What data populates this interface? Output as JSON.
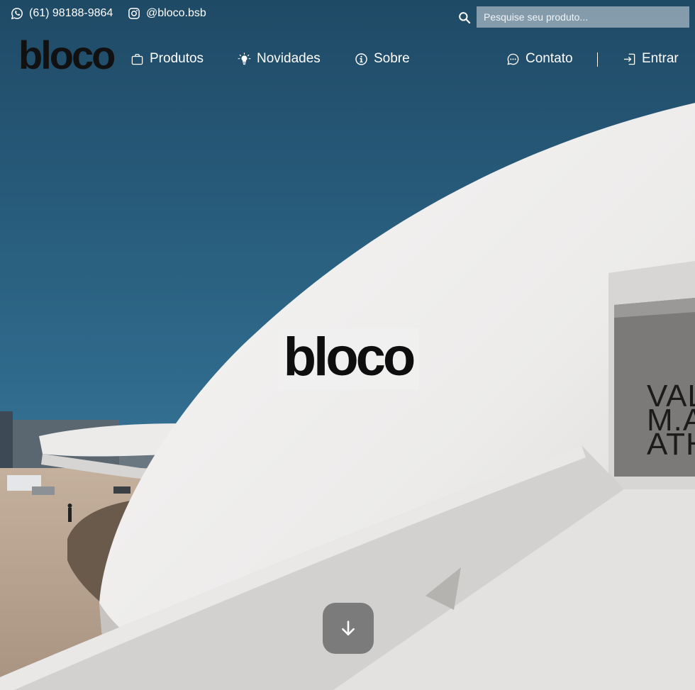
{
  "colors": {
    "sky_top": "#204c68",
    "sky_bottom": "#3a7799",
    "dome": "#f1f0ef",
    "ground": "#b9a593",
    "text": "#ffffff"
  },
  "topbar": {
    "phone": "(61) 98188-9864",
    "phone_icon": "whatsapp-icon",
    "instagram": "@bloco.bsb",
    "instagram_icon": "instagram-icon",
    "search": {
      "placeholder": "Pesquise seu produto...",
      "value": ""
    }
  },
  "brand": {
    "logo_text": "bloco"
  },
  "nav": {
    "items": [
      {
        "label": "Produtos",
        "icon": "shopping-bag-icon"
      },
      {
        "label": "Novidades",
        "icon": "lightbulb-icon"
      },
      {
        "label": "Sobre",
        "icon": "info-icon"
      },
      {
        "label": "Contato",
        "icon": "chat-icon"
      },
      {
        "label": "Entrar",
        "icon": "login-icon"
      }
    ]
  },
  "hero": {
    "center_logo": "bloco",
    "wall_sign": "VAL\nM.A\nATH",
    "scroll_icon": "arrow-down-icon"
  }
}
